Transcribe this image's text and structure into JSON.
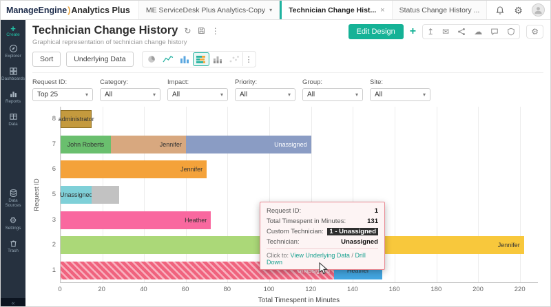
{
  "topbar": {
    "brand": "ManageEngine",
    "paren": ")",
    "product": "Analytics Plus",
    "tabs": [
      {
        "label": "ME ServiceDesk Plus Analytics-Copy"
      },
      {
        "label": "Technician Change Hist..."
      },
      {
        "label": "Status Change History ..."
      }
    ]
  },
  "sidebar": {
    "create": "Create",
    "items": [
      "Explorer",
      "Dashboards",
      "Reports",
      "Data",
      "Data Sources",
      "Settings",
      "Trash"
    ]
  },
  "header": {
    "title": "Technician Change History",
    "subtitle": "Graphical representation of technician change history",
    "edit_design": "Edit Design"
  },
  "toolbar": {
    "sort": "Sort",
    "underlying": "Underlying Data"
  },
  "filters": [
    {
      "label": "Request ID:",
      "value": "Top 25"
    },
    {
      "label": "Category:",
      "value": "All"
    },
    {
      "label": "Impact:",
      "value": "All"
    },
    {
      "label": "Priority:",
      "value": "All"
    },
    {
      "label": "Group:",
      "value": "All"
    },
    {
      "label": "Site:",
      "value": "All"
    }
  ],
  "icons": {
    "caret_down": "▾",
    "close": "×",
    "kebab": "⋮",
    "refresh": "↻",
    "gear": "⚙",
    "cloud": "☁",
    "email": "✉",
    "plus": "+",
    "export": "↥"
  },
  "tooltip": {
    "rows": [
      {
        "label": "Request ID:",
        "value": "1"
      },
      {
        "label": "Total Timespent in Minutes:",
        "value": "131"
      },
      {
        "label": "Custom Technician:",
        "value": "1 - Unassigned"
      },
      {
        "label": "Technician:",
        "value": "Unassigned"
      }
    ],
    "click_to": "Click to:",
    "link1": "View Underlying Data",
    "sep": " / ",
    "link2": "Drill Down"
  },
  "chart_data": {
    "type": "bar",
    "orientation": "horizontal",
    "stacked": true,
    "xlabel": "Total Timespent in Minutes",
    "ylabel": "Request ID",
    "xlim": [
      0,
      220
    ],
    "xticks": [
      0,
      20,
      40,
      60,
      80,
      100,
      120,
      140,
      160,
      180,
      200,
      220
    ],
    "grid": true,
    "bars": [
      {
        "request_id": "8",
        "segments": [
          {
            "label": "administrator",
            "value": 15,
            "color": "#c49a3e",
            "border": "#8f6f22",
            "label_pos": "center"
          }
        ]
      },
      {
        "request_id": "7",
        "segments": [
          {
            "label": "John Roberts",
            "value": 24,
            "color": "#6abf6e",
            "label_pos": "center"
          },
          {
            "label": "Jennifer",
            "value": 36,
            "color": "#d8a87f",
            "label_pos": "right"
          },
          {
            "label": "Unassigned",
            "value": 60,
            "color": "#8a9cc4",
            "label_pos": "right",
            "text": "#ffffff"
          }
        ]
      },
      {
        "request_id": "6",
        "segments": [
          {
            "label": "Jennifer",
            "value": 70,
            "color": "#f4a23a",
            "label_pos": "right"
          }
        ]
      },
      {
        "request_id": "5",
        "segments": [
          {
            "label": "Unassigned",
            "value": 15,
            "color": "#7fd0d8",
            "label_pos": "center"
          },
          {
            "label": "",
            "value": 13,
            "color": "#c2c2c2"
          }
        ]
      },
      {
        "request_id": "3",
        "segments": [
          {
            "label": "Heather",
            "value": 72,
            "color": "#f9689f",
            "label_pos": "right"
          }
        ]
      },
      {
        "request_id": "2",
        "segments": [
          {
            "label": "",
            "value": 120,
            "color": "#abd878"
          },
          {
            "label": "Jennifer",
            "value": 102,
            "color": "#f8c83c",
            "label_pos": "right"
          }
        ]
      },
      {
        "request_id": "1",
        "segments": [
          {
            "label": "Unassigned",
            "value": 131,
            "color": "#f0637e",
            "hatched": true,
            "label_pos": "right",
            "text": "#ffffff"
          },
          {
            "label": "Heather",
            "value": 23,
            "color": "#42a5e0",
            "label_pos": "center"
          }
        ]
      }
    ]
  }
}
